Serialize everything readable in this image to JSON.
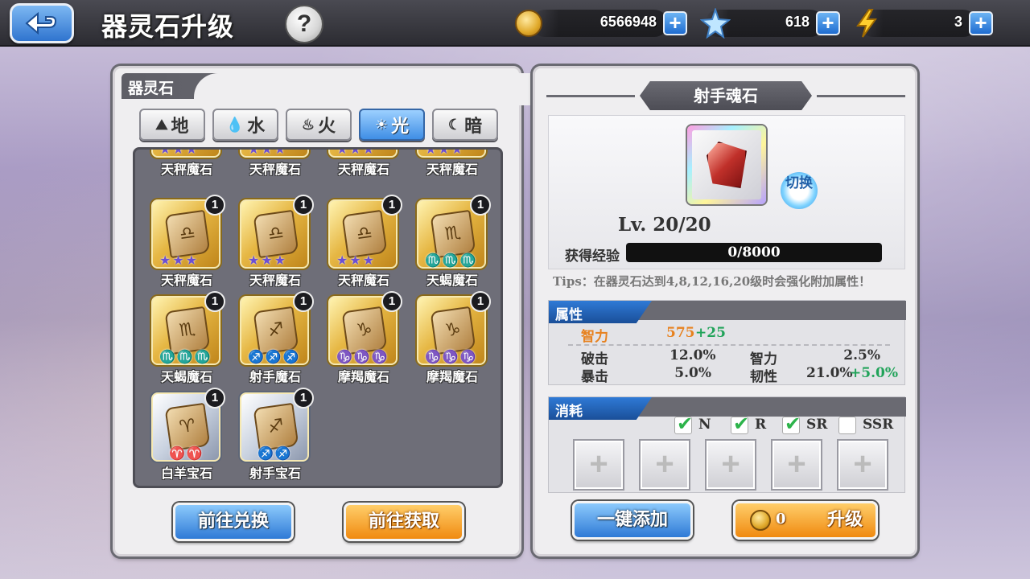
{
  "header": {
    "title": "器灵石升级",
    "help_label": "?",
    "gold": "6566948",
    "crystal": "618",
    "energy": "3"
  },
  "left_panel": {
    "title": "器灵石",
    "tabs": [
      {
        "label": "地",
        "icon": "earth-icon"
      },
      {
        "label": "水",
        "icon": "water-icon"
      },
      {
        "label": "火",
        "icon": "fire-icon"
      },
      {
        "label": "光",
        "icon": "light-icon",
        "active": true
      },
      {
        "label": "暗",
        "icon": "dark-icon"
      }
    ],
    "items": [
      {
        "name": "天秤魔石"
      },
      {
        "name": "天秤魔石"
      },
      {
        "name": "天秤魔石"
      },
      {
        "name": "天秤魔石"
      },
      {
        "name": "天秤魔石",
        "count": "1",
        "glyph": "♎",
        "stars": "★★★"
      },
      {
        "name": "天秤魔石",
        "count": "1",
        "glyph": "♎",
        "stars": "★★★"
      },
      {
        "name": "天秤魔石",
        "count": "1",
        "glyph": "♎",
        "stars": "★★★"
      },
      {
        "name": "天蝎魔石",
        "count": "1",
        "glyph": "♏",
        "stars": "♏♏♏"
      },
      {
        "name": "天蝎魔石",
        "count": "1",
        "glyph": "♏",
        "stars": "♏♏♏"
      },
      {
        "name": "射手魔石",
        "count": "1",
        "glyph": "♐",
        "stars": "♐♐♐"
      },
      {
        "name": "摩羯魔石",
        "count": "1",
        "glyph": "♑",
        "stars": "♑♑♑"
      },
      {
        "name": "摩羯魔石",
        "count": "1",
        "glyph": "♑",
        "stars": "♑♑♑"
      },
      {
        "name": "白羊宝石",
        "count": "1",
        "glyph": "♈",
        "stars": "♈♈"
      },
      {
        "name": "射手宝石",
        "count": "1",
        "glyph": "♐",
        "stars": "♐♐"
      }
    ],
    "exchange_btn": "前往兑换",
    "obtain_btn": "前往获取"
  },
  "right_panel": {
    "title": "射手魂石",
    "switch_label": "切换",
    "level": "Lv. 20/20",
    "exp_label": "获得经验",
    "exp_value": "0/8000",
    "exp_progress": 0,
    "tips": "Tips：在器灵石达到4,8,12,16,20级时会强化附加属性！",
    "attr_title": "属性",
    "main_stat": {
      "name": "智力",
      "value": "575",
      "bonus": "+25"
    },
    "stats": [
      {
        "name": "破击",
        "value": "12.0%"
      },
      {
        "name": "智力",
        "value": "2.5%"
      },
      {
        "name": "暴击",
        "value": "5.0%"
      },
      {
        "name": "韧性",
        "value": "21.0%",
        "bonus": "+5.0%"
      }
    ],
    "consume_title": "消耗",
    "filters": [
      {
        "label": "N",
        "checked": true
      },
      {
        "label": "R",
        "checked": true
      },
      {
        "label": "SR",
        "checked": true
      },
      {
        "label": "SSR",
        "checked": false
      }
    ],
    "slot_symbol": "+",
    "quick_add_btn": "一键添加",
    "upgrade_cost": "0",
    "upgrade_btn": "升级"
  }
}
